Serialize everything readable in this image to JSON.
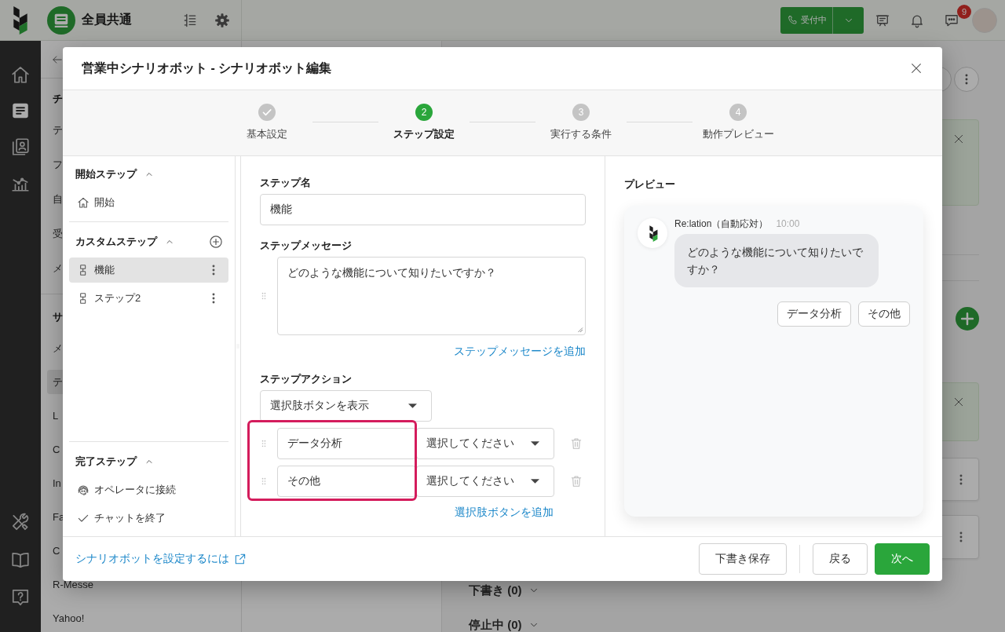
{
  "topbar": {
    "workspace": "全員共通",
    "status_button": "受付中",
    "chat_badge": "9"
  },
  "rail": {
    "top": [
      {
        "kind": "home",
        "selected": false
      },
      {
        "kind": "inbox",
        "selected": true
      },
      {
        "kind": "contacts",
        "selected": false
      },
      {
        "kind": "chart",
        "selected": false
      }
    ],
    "bottom": [
      {
        "kind": "tools",
        "selected": false
      },
      {
        "kind": "book",
        "selected": false
      },
      {
        "kind": "help",
        "selected": false
      }
    ]
  },
  "channel_list": {
    "sections": [
      {
        "title": "チ",
        "items": [
          {
            "label": "テ",
            "selected": false
          },
          {
            "label": "フ",
            "selected": false
          },
          {
            "label": "自",
            "selected": false
          },
          {
            "label": "受",
            "selected": false
          },
          {
            "label": "メ",
            "selected": false
          }
        ]
      },
      {
        "title": "サ",
        "items": [
          {
            "label": "メ",
            "selected": false
          },
          {
            "label": "テ",
            "selected": true
          },
          {
            "label": "L",
            "selected": false
          },
          {
            "label": "C",
            "selected": false
          },
          {
            "label": "In",
            "selected": false
          },
          {
            "label": "Fa",
            "selected": false
          },
          {
            "label": "C",
            "selected": false
          },
          {
            "label": "R-Messe",
            "selected": false
          },
          {
            "label": "Yahoo!",
            "selected": false
          }
        ]
      }
    ]
  },
  "main": {
    "groups": [
      {
        "title": "下書き (0)",
        "expanded": false
      },
      {
        "title": "停止中 (0)",
        "expanded": false
      }
    ]
  },
  "dialog": {
    "title": "営業中シナリオボット - シナリオボット編集",
    "steps": [
      {
        "label": "基本設定",
        "completed": true,
        "selected": false
      },
      {
        "number": "2",
        "label": "ステップ設定",
        "completed": false,
        "selected": true
      },
      {
        "number": "3",
        "label": "実行する条件",
        "completed": false,
        "selected": false
      },
      {
        "number": "4",
        "label": "動作プレビュー",
        "completed": false,
        "selected": false
      }
    ],
    "step_tree": {
      "sections": [
        {
          "title": "開始ステップ",
          "expanded": true,
          "items": [
            {
              "kind": "start",
              "label": "開始",
              "selected": false
            }
          ]
        },
        {
          "title": "カスタムステップ",
          "expanded": true,
          "can_add": true,
          "items": [
            {
              "kind": "custom",
              "label": "機能",
              "selected": true
            },
            {
              "kind": "custom",
              "label": "ステップ2",
              "selected": false
            }
          ]
        },
        {
          "title": "完了ステップ",
          "expanded": true,
          "items": [
            {
              "kind": "operator",
              "label": "オペレータに接続",
              "selected": false
            },
            {
              "kind": "end",
              "label": "チャットを終了",
              "selected": false
            }
          ]
        }
      ]
    },
    "editor": {
      "step_name": {
        "label": "ステップ名",
        "value": "機能"
      },
      "message": {
        "label": "ステップメッセージ",
        "value": "どのような機能について知りたいですか？",
        "add_link": "ステップメッセージを追加"
      },
      "action": {
        "label": "ステップアクション",
        "type": "選択肢ボタンを表示",
        "choices_highlighted": true,
        "choices": [
          {
            "text": "データ分析",
            "target": "選択してください"
          },
          {
            "text": "その他",
            "target": "選択してください"
          }
        ],
        "add_link": "選択肢ボタンを追加"
      }
    },
    "preview": {
      "title": "プレビュー",
      "sender": "Re:lation（自動応対）",
      "time": "10:00",
      "message": "どのような機能について知りたいですか？",
      "choices": [
        "データ分析",
        "その他"
      ]
    },
    "footer": {
      "help_link": "シナリオボットを設定するには",
      "buttons": [
        {
          "kind": "save_draft",
          "label": "下書き保存"
        }
      ],
      "nav_buttons": [
        {
          "kind": "back",
          "label": "戻る"
        },
        {
          "kind": "next",
          "label": "次へ"
        }
      ]
    }
  }
}
